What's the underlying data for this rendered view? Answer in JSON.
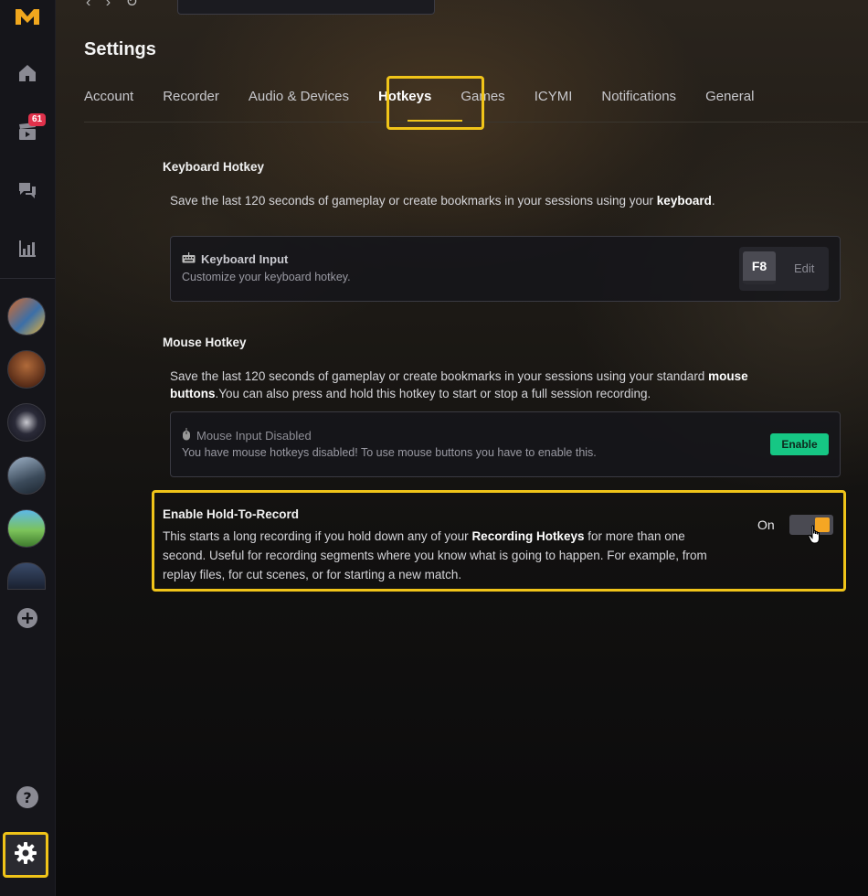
{
  "sidebar": {
    "logo_icon": "medal-logo-icon",
    "items": [
      {
        "name": "home",
        "icon": "home-icon"
      },
      {
        "name": "clips",
        "icon": "clapperboard-icon",
        "badge": "61"
      },
      {
        "name": "messages",
        "icon": "chat-icon"
      },
      {
        "name": "stats",
        "icon": "bar-chart-icon"
      }
    ],
    "games": [
      "game-1",
      "game-2",
      "game-3",
      "game-4",
      "game-5",
      "game-6"
    ],
    "add_icon": "plus-circle-icon",
    "help_icon": "question-circle-icon",
    "settings_icon": "gear-icon"
  },
  "page": {
    "title": "Settings"
  },
  "tabs": [
    {
      "label": "Account",
      "active": false
    },
    {
      "label": "Recorder",
      "active": false
    },
    {
      "label": "Audio & Devices",
      "active": false
    },
    {
      "label": "Hotkeys",
      "active": true
    },
    {
      "label": "Games",
      "active": false
    },
    {
      "label": "ICYMI",
      "active": false
    },
    {
      "label": "Notifications",
      "active": false
    },
    {
      "label": "General",
      "active": false
    }
  ],
  "keyboard": {
    "title": "Keyboard Hotkey",
    "desc_prefix": "Save the last 120 seconds of gameplay or create bookmarks in your sessions using your ",
    "desc_bold": "keyboard",
    "desc_suffix": ".",
    "card_title": "Keyboard Input",
    "card_sub": "Customize your keyboard hotkey.",
    "key": "F8",
    "edit_label": "Edit"
  },
  "mouse": {
    "title": "Mouse Hotkey",
    "desc_prefix": "Save the last 120 seconds of gameplay or create bookmarks in your sessions using your standard ",
    "desc_bold": "mouse buttons",
    "desc_suffix": ".You can also press and hold this hotkey to start or stop a full session recording.",
    "card_title": "Mouse Input Disabled",
    "card_sub": "You have mouse hotkeys disabled! To use mouse buttons you have to enable this.",
    "enable_label": "Enable"
  },
  "hold": {
    "title": "Enable Hold-To-Record",
    "desc_prefix": "This starts a long recording if you hold down any of your ",
    "desc_bold": "Recording Hotkeys",
    "desc_suffix": " for more than one second. Useful for recording segments where you know what is going to happen. For example, from replay files, for cut scenes, or for starting a new match.",
    "toggle_label": "On",
    "toggle_on": true
  },
  "colors": {
    "accent": "#f0c419",
    "toggle_knob": "#f5a623",
    "enable_button": "#16c784",
    "badge": "#e0314b"
  }
}
